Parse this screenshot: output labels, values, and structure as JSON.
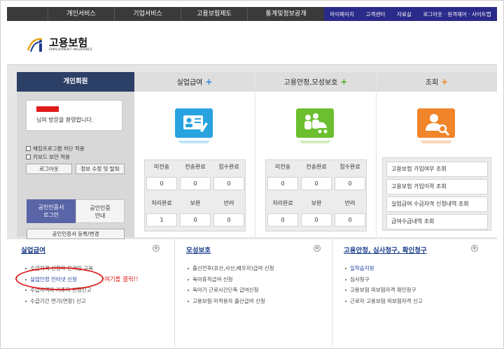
{
  "topnav": {
    "items": [
      "개인서비스",
      "기업서비스",
      "고용보험제도",
      "통계및정보공개"
    ],
    "utilities": [
      "마이페이지",
      "고객센터",
      "자료실",
      "로그아웃 · 원격제어 · 사이트맵"
    ]
  },
  "logo": {
    "title": "고용보험",
    "subtitle": "EMPLOYMENT INSURANCE"
  },
  "member": {
    "header": "개인회원",
    "welcome": "님의 방문을 환영합니다.",
    "checkbox1": "해킹프로그램 차단 적용",
    "checkbox2": "키보드 보안 적용",
    "logout_button": "로그아웃",
    "edit_button": "정보 수정 및 탈퇴",
    "cert_login_line1": "공인인증서",
    "cert_login_line2": "로그인",
    "cert_guide_line1": "공인인증",
    "cert_guide_line2": "안내",
    "cert_register": "공인인증서 등록/변경"
  },
  "col1": {
    "title": "실업급여",
    "plus": "+",
    "headers1": [
      "미전송",
      "전송완료",
      "접수완료"
    ],
    "values1": [
      "0",
      "0",
      "0"
    ],
    "headers2": [
      "처리완료",
      "보완",
      "반려"
    ],
    "values2": [
      "1",
      "0",
      "0"
    ]
  },
  "col2": {
    "title": "고용안정,모성보호",
    "plus": "+",
    "headers1": [
      "미전송",
      "전송완료",
      "접수완료"
    ],
    "values1": [
      "0",
      "0",
      "0"
    ],
    "headers2": [
      "처리완료",
      "보완",
      "반려"
    ],
    "values2": [
      "0",
      "0",
      "0"
    ]
  },
  "col3": {
    "title": "조회",
    "plus": "+",
    "links": [
      "고용보험 가입여부 조회",
      "고용보험 가입이력 조회",
      "실업급여 수급자격 신청내역 조회",
      "급여수급내역 조회"
    ]
  },
  "sections": [
    {
      "title": "실업급여",
      "items": [
        "수급자격 신청자 온라인 교육",
        "실업인정 인터넷 신청",
        "수급자격자 거주지 변경신고",
        "수급기간 연기(연장) 신고"
      ]
    },
    {
      "title": "모성보호",
      "items": [
        "출산전후(유산,사산,배우자)급여 신청",
        "육아휴직급여 신청",
        "육아기 근로시간단축 급여신청",
        "고용보험 미적용자 출산급여 신청"
      ]
    },
    {
      "title": "고용안정, 심사청구, 확인청구",
      "items": [
        "일학습지원",
        "심사청구",
        "고용보험 피보험자격 확인청구",
        "근로자 고용보험 피보험자격 신고"
      ]
    }
  ],
  "annotation": "여기를 클릭!!",
  "colors": {
    "nav_bg": "#3a3a3a",
    "util_bg": "#2a2a8a",
    "member_head": "#2c3f66",
    "col1_icon": "#29a3e0",
    "col2_icon": "#6cbf2e",
    "col3_icon": "#f0852a",
    "col1_plus": "#2a8ad8",
    "col2_plus": "#4caf24",
    "col3_plus": "#f08a25",
    "annotation": "#e01b1b"
  }
}
